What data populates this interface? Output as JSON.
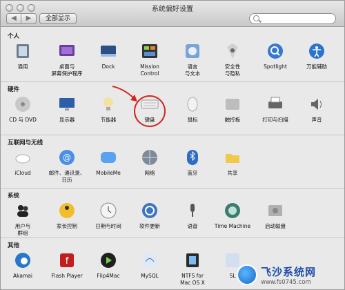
{
  "window": {
    "title": "系统偏好设置",
    "show_all": "全部显示",
    "back": "◀",
    "forward": "▶"
  },
  "sections": [
    {
      "label": "个人",
      "items": [
        {
          "label": "通用",
          "icon": "general-icon"
        },
        {
          "label": "桌面与\n屏幕保护程序",
          "icon": "desktop-screensaver-icon"
        },
        {
          "label": "Dock",
          "icon": "dock-icon"
        },
        {
          "label": "Mission\nControl",
          "icon": "mission-control-icon"
        },
        {
          "label": "语言\n与文本",
          "icon": "language-text-icon"
        },
        {
          "label": "安全性\n与隐私",
          "icon": "security-privacy-icon"
        },
        {
          "label": "Spotlight",
          "icon": "spotlight-icon"
        },
        {
          "label": "万能辅助",
          "icon": "universal-access-icon"
        }
      ]
    },
    {
      "label": "硬件",
      "items": [
        {
          "label": "CD 与 DVD",
          "icon": "cd-dvd-icon"
        },
        {
          "label": "显示器",
          "icon": "displays-icon"
        },
        {
          "label": "节能器",
          "icon": "energy-saver-icon"
        },
        {
          "label": "键盘",
          "icon": "keyboard-icon"
        },
        {
          "label": "鼠标",
          "icon": "mouse-icon"
        },
        {
          "label": "触控板",
          "icon": "trackpad-icon"
        },
        {
          "label": "打印与扫描",
          "icon": "print-scan-icon"
        },
        {
          "label": "声音",
          "icon": "sound-icon"
        }
      ]
    },
    {
      "label": "互联网与无线",
      "items": [
        {
          "label": "iCloud",
          "icon": "icloud-icon"
        },
        {
          "label": "邮件、通讯录、\n日历",
          "icon": "mail-contacts-calendars-icon"
        },
        {
          "label": "MobileMe",
          "icon": "mobileme-icon"
        },
        {
          "label": "网络",
          "icon": "network-icon"
        },
        {
          "label": "蓝牙",
          "icon": "bluetooth-icon"
        },
        {
          "label": "共享",
          "icon": "sharing-icon"
        }
      ]
    },
    {
      "label": "系统",
      "items": [
        {
          "label": "用户与\n群组",
          "icon": "users-groups-icon"
        },
        {
          "label": "家长控制",
          "icon": "parental-controls-icon"
        },
        {
          "label": "日期与时间",
          "icon": "date-time-icon"
        },
        {
          "label": "软件更新",
          "icon": "software-update-icon"
        },
        {
          "label": "语音",
          "icon": "speech-icon"
        },
        {
          "label": "Time Machine",
          "icon": "time-machine-icon"
        },
        {
          "label": "启动磁盘",
          "icon": "startup-disk-icon"
        }
      ]
    },
    {
      "label": "其他",
      "items": [
        {
          "label": "Akamai",
          "icon": "akamai-icon"
        },
        {
          "label": "Flash Player",
          "icon": "flash-player-icon"
        },
        {
          "label": "Flip4Mac",
          "icon": "flip4mac-icon"
        },
        {
          "label": "MySQL",
          "icon": "mysql-icon"
        },
        {
          "label": "NTFS for\nMac OS X",
          "icon": "ntfs-icon"
        },
        {
          "label": "SL",
          "icon": "sl-icon"
        }
      ]
    }
  ],
  "watermark": {
    "title": "飞沙系统网",
    "url": "www.fs0745.com"
  },
  "colors": {
    "annotation": "#d1261f",
    "accent": "#1667c7"
  }
}
